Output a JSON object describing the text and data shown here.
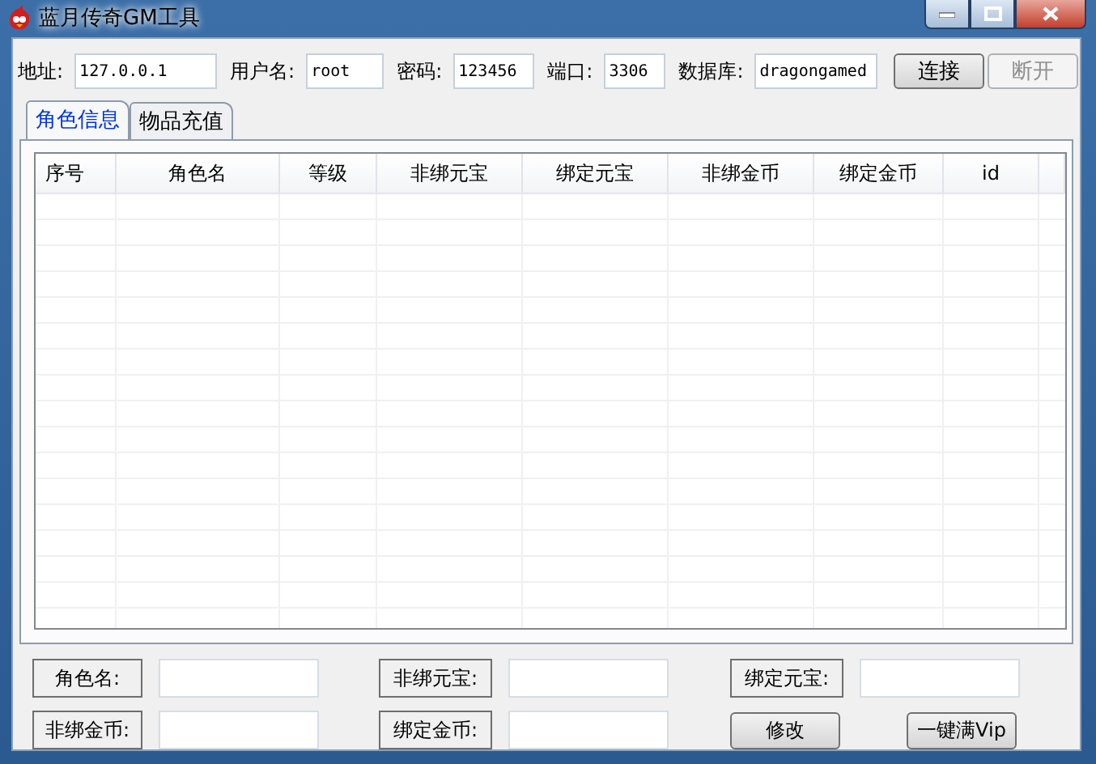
{
  "window": {
    "title": "蓝月传奇GM工具"
  },
  "connection": [
    {
      "label": "地址:",
      "value": "127.0.0.1"
    },
    {
      "label": "用户名:",
      "value": "root"
    },
    {
      "label": "密码:",
      "value": "123456"
    },
    {
      "label": "端口:",
      "value": "3306"
    },
    {
      "label": "数据库:",
      "value": "dragongamed"
    }
  ],
  "connection_buttons": [
    {
      "label": "连接",
      "disabled": false
    },
    {
      "label": "断开",
      "disabled": true
    }
  ],
  "tabs": [
    {
      "label": "角色信息",
      "selected": true
    },
    {
      "label": "物品充值",
      "selected": false
    }
  ],
  "table": {
    "columns": [
      "序号",
      "角色名",
      "等级",
      "非绑元宝",
      "绑定元宝",
      "非绑金币",
      "绑定金币",
      "id"
    ]
  },
  "edit_form": {
    "fields": [
      {
        "label": "角色名:"
      },
      {
        "label": "非绑元宝:"
      },
      {
        "label": "绑定元宝:"
      },
      {
        "label": "非绑金币:"
      },
      {
        "label": "绑定金币:"
      }
    ],
    "buttons": [
      "修改",
      "一键满Vip"
    ]
  }
}
